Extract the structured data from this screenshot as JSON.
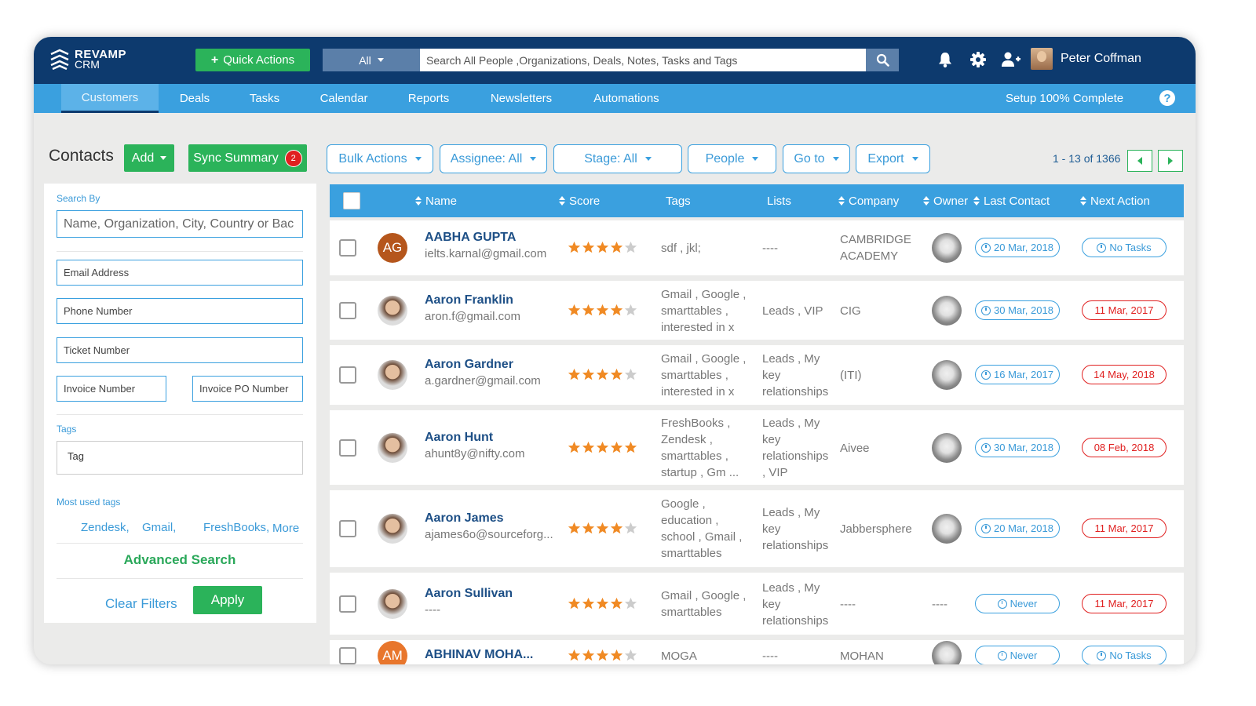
{
  "brand": {
    "line1": "REVAMP",
    "line2": "CRM"
  },
  "header": {
    "quick_actions": "Quick Actions",
    "search_scope": "All",
    "search_placeholder": "Search All People ,Organizations, Deals, Notes, Tasks and Tags",
    "user_name": "Peter Coffman"
  },
  "nav": {
    "items": [
      "Customers",
      "Deals",
      "Tasks",
      "Calendar",
      "Reports",
      "Newsletters",
      "Automations"
    ],
    "active": "Customers",
    "setup": "Setup 100% Complete"
  },
  "toolbar": {
    "title": "Contacts",
    "add": "Add",
    "sync": "Sync Summary",
    "sync_count": "2",
    "filters": [
      "Bulk Actions",
      "Assignee: All",
      "Stage: All",
      "People",
      "Go to",
      "Export"
    ],
    "pager": "1 - 13 of 1366"
  },
  "sidebar": {
    "search_by": "Search By",
    "main_placeholder": "Name, Organization, City, Country or Bac",
    "email_placeholder": "Email Address",
    "phone_placeholder": "Phone Number",
    "ticket_placeholder": "Ticket Number",
    "invoice_placeholder": "Invoice Number",
    "invoice_po_placeholder": "Invoice PO Number",
    "tags_label": "Tags",
    "tag_placeholder": "Tag",
    "most_used_label": "Most used tags",
    "most_used": [
      "Zendesk,",
      "Gmail,",
      "FreshBooks,"
    ],
    "more": "More",
    "advanced": "Advanced Search",
    "clear": "Clear Filters",
    "apply": "Apply"
  },
  "table": {
    "columns": [
      "Name",
      "Score",
      "Tags",
      "Lists",
      "Company",
      "Owner",
      "Last Contact",
      "Next Action"
    ],
    "rows": [
      {
        "name": "AABHA GUPTA",
        "email": "ielts.karnal@gmail.com",
        "initials": "AG",
        "avatar_color": "#b5561c",
        "score": 4,
        "tags": [
          "sdf , jkl;"
        ],
        "lists": [
          "----"
        ],
        "company": [
          "CAMBRIDGE",
          "ACADEMY"
        ],
        "last_contact": "20 Mar, 2018",
        "next_action": "No Tasks",
        "next_style": "blue"
      },
      {
        "name": "Aaron Franklin",
        "email": "aron.f@gmail.com",
        "initials": "",
        "score": 4,
        "tags": [
          "Gmail , Google ,",
          "smarttables ,",
          "interested in x"
        ],
        "lists": [
          "Leads , VIP"
        ],
        "company": [
          "CIG"
        ],
        "last_contact": "30 Mar, 2018",
        "next_action": "11 Mar, 2017",
        "next_style": "red"
      },
      {
        "name": "Aaron Gardner",
        "email": "a.gardner@gmail.com",
        "initials": "",
        "score": 4,
        "tags": [
          "Gmail , Google ,",
          "smarttables ,",
          "interested in x"
        ],
        "lists": [
          "Leads , My",
          "key",
          "relationships"
        ],
        "company": [
          "(ITI)"
        ],
        "last_contact": "16 Mar, 2017",
        "next_action": "14 May, 2018",
        "next_style": "red"
      },
      {
        "name": "Aaron Hunt",
        "email": "ahunt8y@nifty.com",
        "initials": "",
        "score": 5,
        "tags": [
          "FreshBooks ,",
          "Zendesk ,",
          "smarttables ,",
          "startup , Gm ..."
        ],
        "lists": [
          "Leads , My",
          "key",
          "relationships",
          ", VIP"
        ],
        "company": [
          "Aivee"
        ],
        "last_contact": "30 Mar, 2018",
        "next_action": "08 Feb, 2018",
        "next_style": "red"
      },
      {
        "name": "Aaron James",
        "email": "ajames6o@sourceforg...",
        "initials": "",
        "score": 4,
        "tags": [
          "Google ,",
          "education ,",
          "school , Gmail ,",
          "smarttables"
        ],
        "lists": [
          "Leads , My",
          "key",
          "relationships"
        ],
        "company": [
          "Jabbersphere"
        ],
        "last_contact": "20 Mar, 2018",
        "next_action": "11 Mar, 2017",
        "next_style": "red"
      },
      {
        "name": "Aaron Sullivan",
        "email": "----",
        "initials": "",
        "score": 4,
        "tags": [
          "Gmail , Google ,",
          "smarttables"
        ],
        "lists": [
          "Leads , My",
          "key",
          "relationships"
        ],
        "company": [
          "----"
        ],
        "owner": "----",
        "last_contact": "Never",
        "next_action": "11 Mar, 2017",
        "next_style": "red"
      },
      {
        "name": "ABHINAV MOHA...",
        "email": "",
        "initials": "AM",
        "avatar_color": "#e8762c",
        "score": 4,
        "tags": [
          "MOGA"
        ],
        "lists": [
          "----"
        ],
        "company": [
          "MOHAN"
        ],
        "last_contact": "Never",
        "next_action": "No Tasks",
        "next_style": "blue"
      }
    ]
  },
  "colors": {
    "topbar": "#0d3a6e",
    "navbar": "#3aa0df",
    "green": "#2bb35a",
    "star": "#f08a24",
    "red": "#e02020"
  }
}
